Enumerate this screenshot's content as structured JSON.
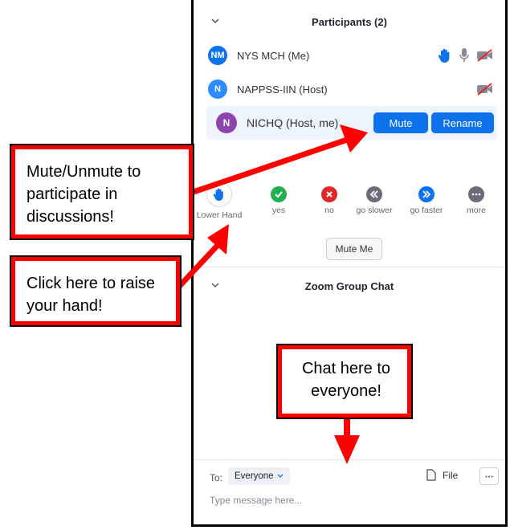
{
  "participants": {
    "header": "Participants (2)",
    "rows": [
      {
        "initials": "NM",
        "name": "NYS MCH (Me)",
        "color": "#0e72ed"
      },
      {
        "initials": "N",
        "name": "NAPPSS-IIN (Host)",
        "color": "#2d8cff"
      },
      {
        "initials": "N",
        "name": "NICHQ (Host, me)",
        "color": "#8e44ad"
      }
    ],
    "mute_label": "Mute",
    "rename_label": "Rename"
  },
  "reactions": [
    {
      "label": "Lower Hand",
      "icon": "raised-hand-icon",
      "color": "#0e72ed"
    },
    {
      "label": "yes",
      "icon": "check-icon",
      "color": "#20b050"
    },
    {
      "label": "no",
      "icon": "x-icon",
      "color": "#e02828"
    },
    {
      "label": "go slower",
      "icon": "rewind-icon",
      "color": "#6b6b7a"
    },
    {
      "label": "go faster",
      "icon": "fast-forward-icon",
      "color": "#0e72ed"
    },
    {
      "label": "more",
      "icon": "ellipsis-icon",
      "color": "#6b6b7a"
    }
  ],
  "mute_me_label": "Mute Me",
  "chat": {
    "header": "Zoom Group Chat",
    "to_label": "To:",
    "recipient": "Everyone",
    "file_label": "File",
    "placeholder": "Type message here..."
  },
  "callouts": {
    "mute": "Mute/Unmute to participate in discussions!",
    "hand": "Click here to raise your hand!",
    "chat": "Chat here to everyone!"
  },
  "colors": {
    "accent": "#0e72ed",
    "callout_border": "#ff0000"
  }
}
